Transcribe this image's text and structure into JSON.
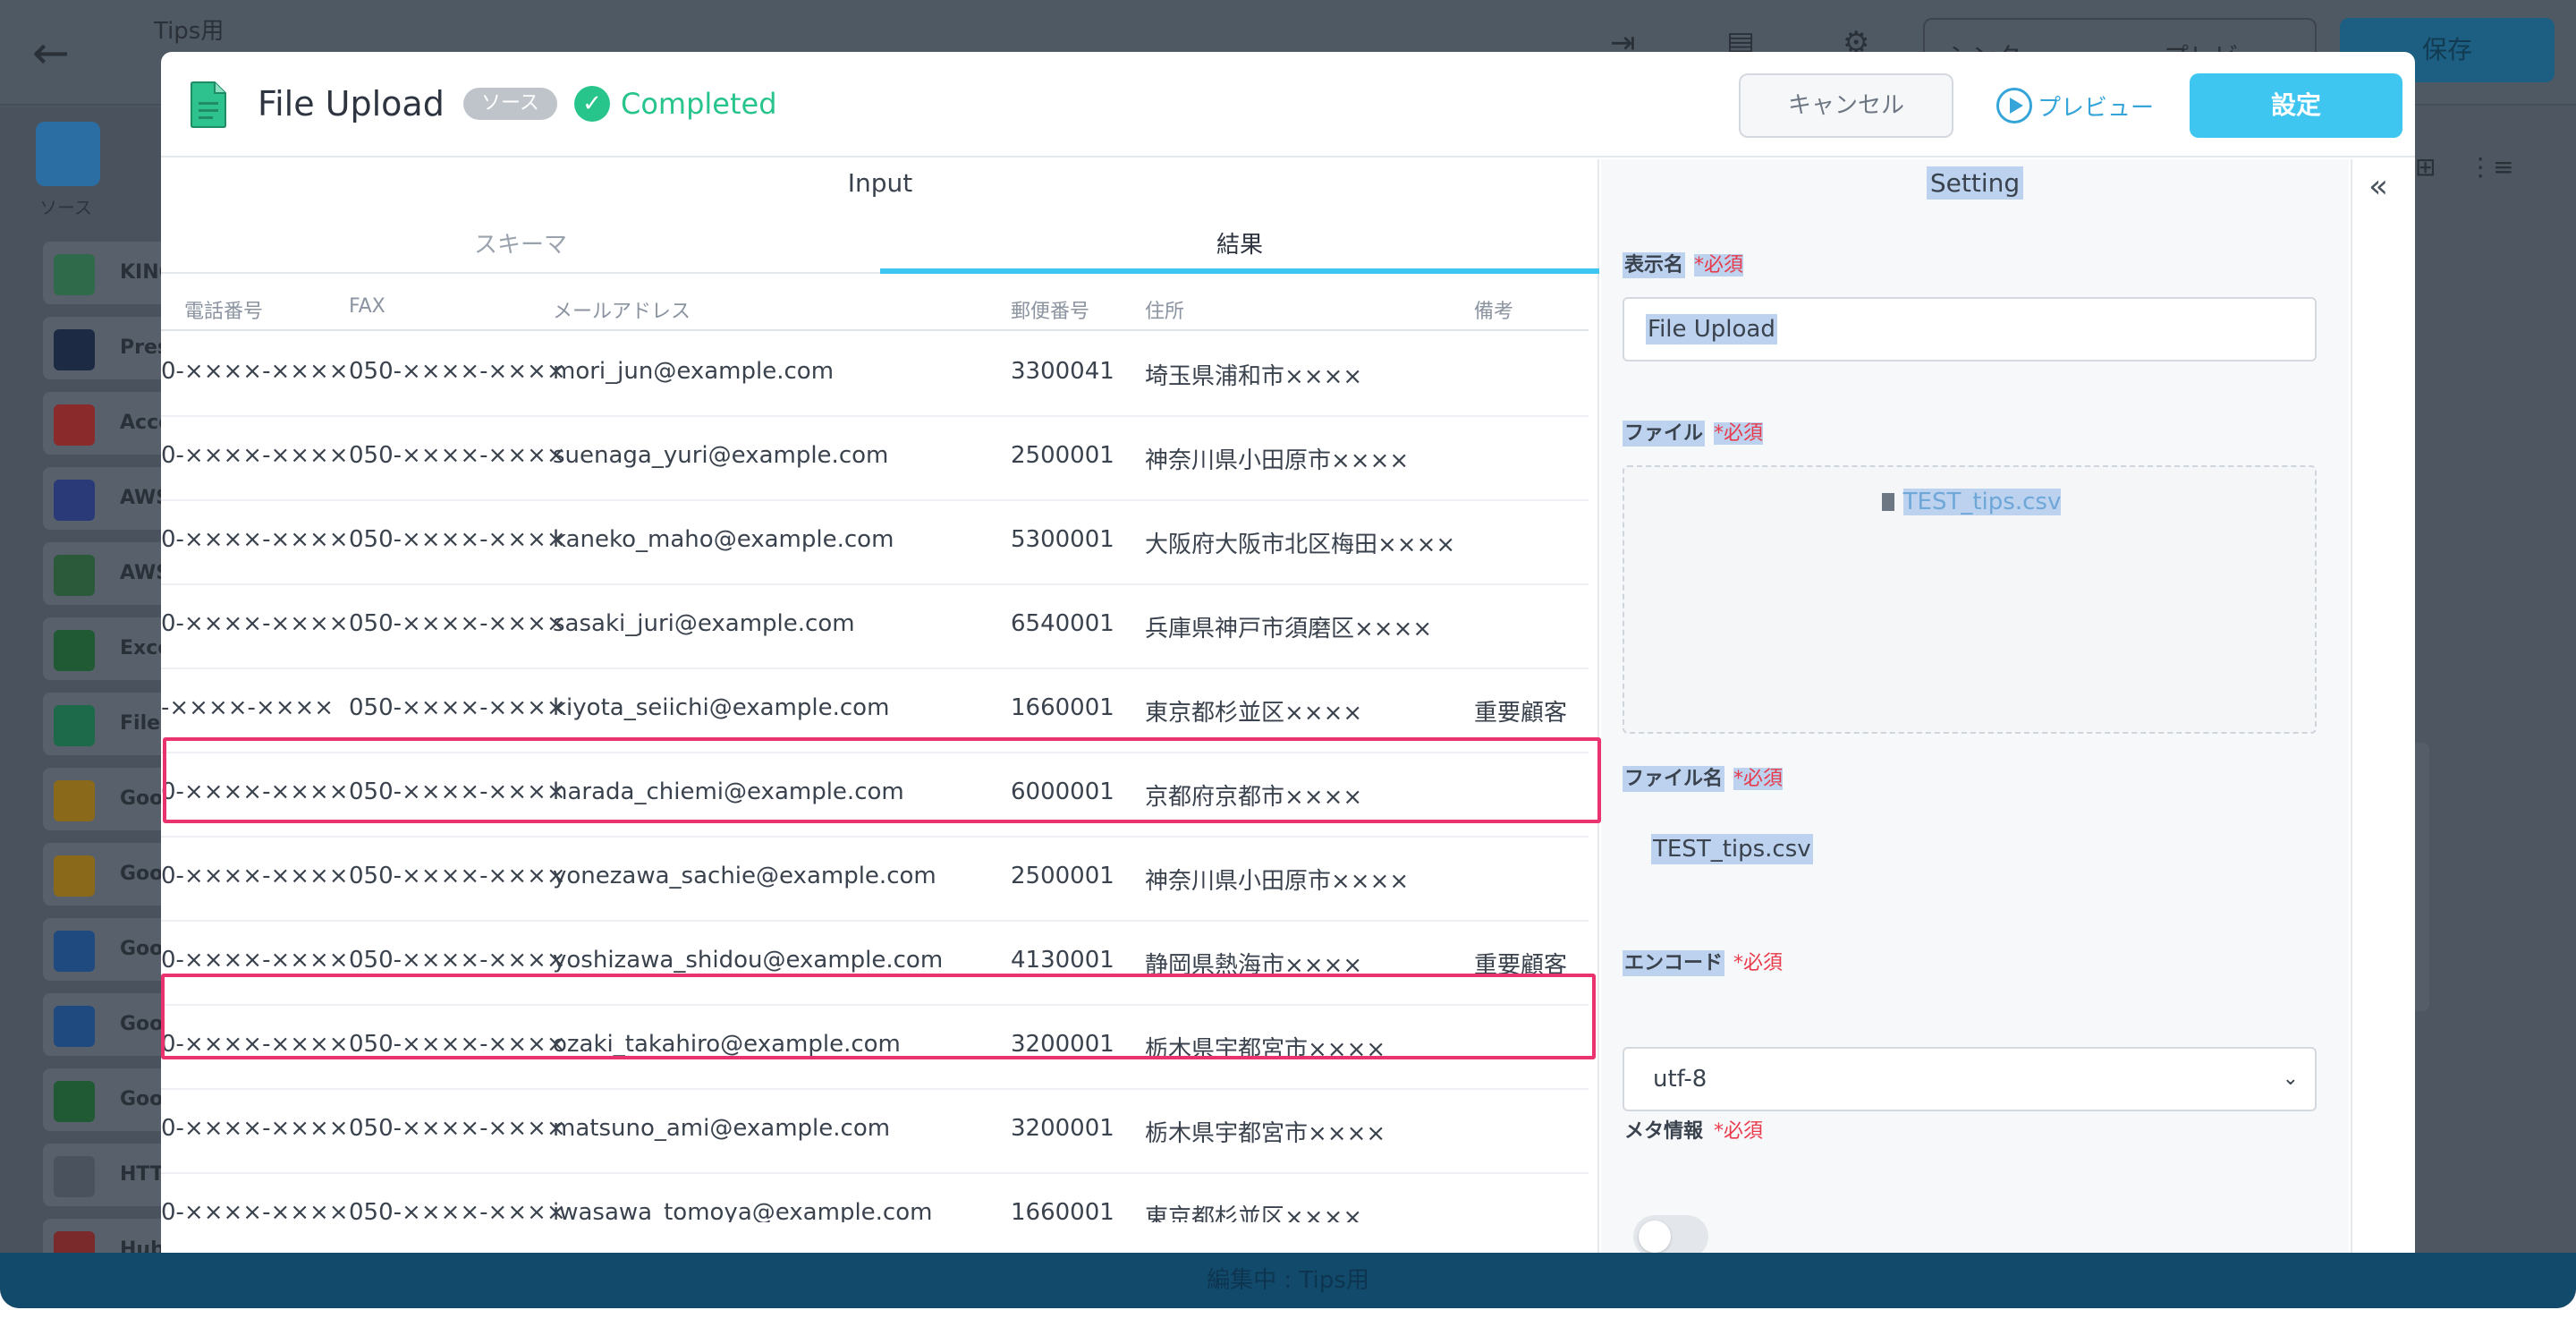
{
  "background": {
    "project_title": "Tips用",
    "sync_label": "シンク",
    "preview_label": "プレビュー",
    "save_label": "保存",
    "source_label": "ソース",
    "sidebar_items": [
      {
        "label": "KINO",
        "color": "#2f6a4a"
      },
      {
        "label": "Pres",
        "color": "#1d2a44"
      },
      {
        "label": "Acce",
        "color": "#8a2a2a"
      },
      {
        "label": "AWS",
        "color": "#2a3a78"
      },
      {
        "label": "AWS",
        "color": "#2a5a3a"
      },
      {
        "label": "Exce",
        "color": "#1f5a34"
      },
      {
        "label": "File",
        "color": "#1c6a4a"
      },
      {
        "label": "Goo",
        "color": "#8a6a1a"
      },
      {
        "label": "Goo",
        "color": "#8a6a1a"
      },
      {
        "label": "Goo",
        "color": "#1f4a80"
      },
      {
        "label": "Goo",
        "color": "#1f4a80"
      },
      {
        "label": "Goo",
        "color": "#1f5a34"
      },
      {
        "label": "HTT",
        "color": "#4a535d"
      },
      {
        "label": "Hub",
        "color": "#7a2a2a"
      }
    ],
    "footer_text": "編集中 : Tips用"
  },
  "modal": {
    "title": "File Upload",
    "badge": "ソース",
    "status": "Completed",
    "cancel_label": "キャンセル",
    "preview_label": "プレビュー",
    "settings_label": "設定"
  },
  "input_pane": {
    "title": "Input",
    "tabs": [
      {
        "label": "スキーマ"
      },
      {
        "label": "結果"
      }
    ],
    "columns": [
      "電話番号",
      "FAX",
      "メールアドレス",
      "郵便番号",
      "住所",
      "備考"
    ],
    "rows": [
      {
        "phone": "0-××××-××××",
        "fax": "050-××××-××××",
        "email": "mori_jun@example.com",
        "zip": "3300041",
        "address": "埼玉県浦和市××××",
        "note": ""
      },
      {
        "phone": "0-××××-××××",
        "fax": "050-××××-××××",
        "email": "suenaga_yuri@example.com",
        "zip": "2500001",
        "address": "神奈川県小田原市××××",
        "note": ""
      },
      {
        "phone": "0-××××-××××",
        "fax": "050-××××-××××",
        "email": "kaneko_maho@example.com",
        "zip": "5300001",
        "address": "大阪府大阪市北区梅田××××",
        "note": ""
      },
      {
        "phone": "0-××××-××××",
        "fax": "050-××××-××××",
        "email": "sasaki_juri@example.com",
        "zip": "6540001",
        "address": "兵庫県神戸市須磨区××××",
        "note": ""
      },
      {
        "phone": "-××××-××××",
        "fax": "050-××××-××××",
        "email": "kiyota_seiichi@example.com",
        "zip": "1660001",
        "address": "東京都杉並区××××",
        "note": "重要顧客"
      },
      {
        "phone": "0-××××-××××",
        "fax": "050-××××-××××",
        "email": "harada_chiemi@example.com",
        "zip": "6000001",
        "address": "京都府京都市××××",
        "note": ""
      },
      {
        "phone": "0-××××-××××",
        "fax": "050-××××-××××",
        "email": "yonezawa_sachie@example.com",
        "zip": "2500001",
        "address": "神奈川県小田原市××××",
        "note": ""
      },
      {
        "phone": "0-××××-××××",
        "fax": "050-××××-××××",
        "email": "yoshizawa_shidou@example.com",
        "zip": "4130001",
        "address": "静岡県熱海市××××",
        "note": "重要顧客"
      },
      {
        "phone": "0-××××-××××",
        "fax": "050-××××-××××",
        "email": "ozaki_takahiro@example.com",
        "zip": "3200001",
        "address": "栃木県宇都宮市××××",
        "note": ""
      },
      {
        "phone": "0-××××-××××",
        "fax": "050-××××-××××",
        "email": "matsuno_ami@example.com",
        "zip": "3200001",
        "address": "栃木県宇都宮市××××",
        "note": ""
      },
      {
        "phone": "0-××××-××××",
        "fax": "050-××××-××××",
        "email": "iwasawa_tomoya@example.com",
        "zip": "1660001",
        "address": "東京都杉並区××××",
        "note": ""
      }
    ],
    "highlight_color": "#e8336e"
  },
  "setting_pane": {
    "title": "Setting",
    "required_mark": "*必須",
    "display_name_label": "表示名",
    "display_name_value": "File Upload",
    "file_label": "ファイル",
    "file_value": "TEST_tips.csv",
    "file_name_label": "ファイル名",
    "file_name_value": "TEST_tips.csv",
    "encoding_label": "エンコード",
    "encoding_value": "utf-8",
    "meta_label": "メタ情報",
    "meta_enabled": false
  },
  "colors": {
    "accent": "#3ec6f0",
    "success": "#27c48c",
    "required": "#e83a4a"
  }
}
